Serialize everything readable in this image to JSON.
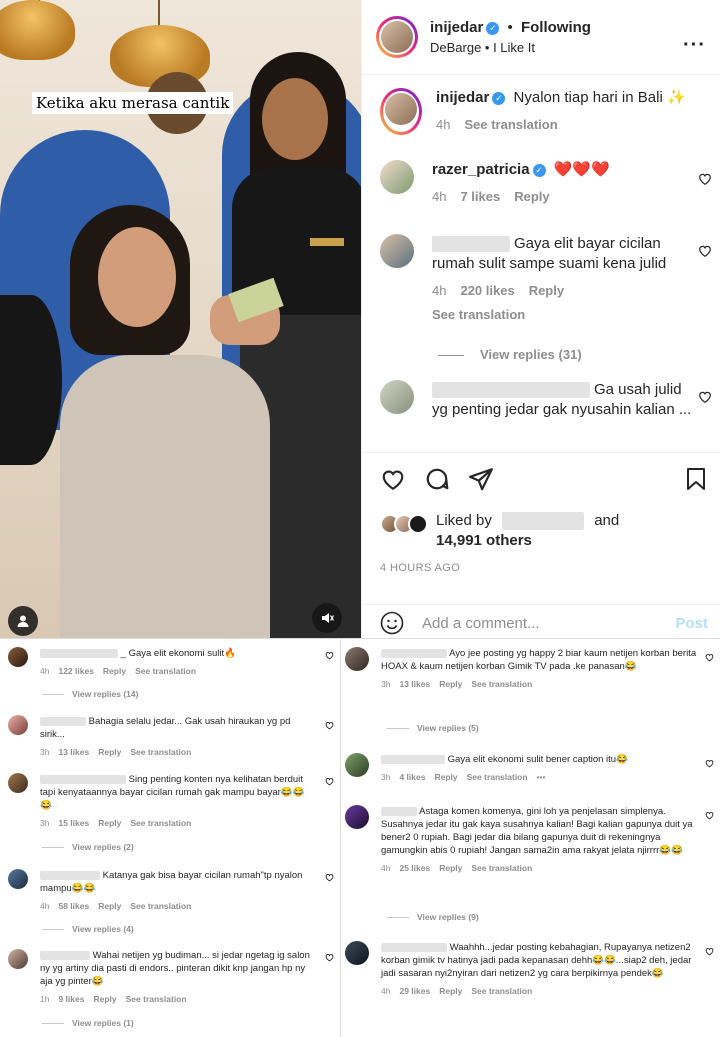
{
  "photo": {
    "overlay_text": "Ketika aku merasa cantik",
    "user_icon": "user-icon",
    "mute_icon": "speaker-icon"
  },
  "header": {
    "username": "inijedar",
    "separator": "•",
    "follow_label": "Following",
    "audio": "DeBarge • I Like It",
    "more_icon": "more-icon"
  },
  "caption": {
    "username": "inijedar",
    "text": "Nyalon tiap hari in Bali ✨",
    "time": "4h",
    "see_translation": "See translation"
  },
  "comments": [
    {
      "username": "razer_patricia",
      "text": "❤️❤️❤️",
      "time": "4h",
      "likes": "7 likes",
      "reply": "Reply"
    },
    {
      "text": "Gaya elit bayar cicilan rumah sulit sampe suami kena julid",
      "time": "4h",
      "likes": "220 likes",
      "reply": "Reply",
      "see_translation": "See translation",
      "view_replies": "View replies (31)"
    },
    {
      "text": "Ga usah julid yg penting jedar gak nyusahin kalian ..."
    }
  ],
  "actions": {
    "like_icon": "heart-icon",
    "comment_icon": "comment-icon",
    "share_icon": "send-icon",
    "save_icon": "bookmark-icon"
  },
  "likes": {
    "liked_by": "Liked by",
    "and": "and",
    "others": "14,991 others"
  },
  "time_ago": "4 HOURS AGO",
  "add_comment": {
    "placeholder": "Add a comment...",
    "post_label": "Post",
    "emoji_icon": "emoji-icon"
  },
  "bottom_left": [
    {
      "text": "_ Gaya elit ekonomi sulit🔥",
      "time": "4h",
      "likes": "122 likes",
      "reply": "Reply",
      "see": "See translation",
      "view_replies": "View replies (14)"
    },
    {
      "text": "Bahagia selalu jedar... Gak usah hiraukan yg pd sirik...",
      "time": "3h",
      "likes": "13 likes",
      "reply": "Reply",
      "see": "See translation"
    },
    {
      "text": "Sing penting konten nya kelihatan berduit tapi kenyataannya bayar cicilan rumah gak mampu bayar😂😂😂",
      "time": "3h",
      "likes": "15 likes",
      "reply": "Reply",
      "see": "See translation",
      "view_replies": "View replies (2)"
    },
    {
      "text": "Katanya gak bisa bayar cicilan rumah\"tp nyalon mampu😂😂",
      "time": "4h",
      "likes": "58 likes",
      "reply": "Reply",
      "see": "See translation",
      "view_replies": "View replies (4)"
    },
    {
      "text": "Wahai netijen yg budiman... si jedar ngetag ig salon ny yg artiny dia pasti di endors.. pinteran dikit knp jangan hp ny aja yg pinter😂",
      "time": "1h",
      "likes": "9 likes",
      "reply": "Reply",
      "see": "See translation",
      "view_replies": "View replies (1)"
    }
  ],
  "bottom_right": [
    {
      "text": "Ayo jee posting yg happy 2 biar kaum netijen korban berita HOAX & kaum netijen korban Gimik TV pada .ke panasan😂",
      "time": "3h",
      "likes": "13 likes",
      "reply": "Reply",
      "see": "See translation",
      "view_replies": "View replies (5)"
    },
    {
      "text": "Gaya elit ekonomi sulit bener caption itu😂",
      "time": "3h",
      "likes": "4 likes",
      "reply": "Reply",
      "see": "See translation",
      "more": "•••"
    },
    {
      "text": "Astaga komen komenya, gini loh ya penjelasan simplenya. Susahnya jedar itu gak kaya susahnya kalian! Bagi kalian gapunya duit ya bener2 0 rupiah. Bagi jedar dia bilang gapunya duit di rekeningnya gamungkin abis 0 rupiah! Jangan sama2in ama rakyat jelata njirrrr😂😂",
      "time": "4h",
      "likes": "25 likes",
      "reply": "Reply",
      "see": "See translation",
      "view_replies": "View replies (9)"
    },
    {
      "text": "Waahhh...jedar posting kebahagian, Rupayanya netizen2 korban gimik tv hatinya jadi pada kepanasan dehh😂😂...siap2 deh, jedar jadi sasaran nyi2nyiran dari netizen2 yg cara berpikirnya pendek😂",
      "time": "4h",
      "likes": "29 likes",
      "reply": "Reply",
      "see": "See translation"
    }
  ]
}
